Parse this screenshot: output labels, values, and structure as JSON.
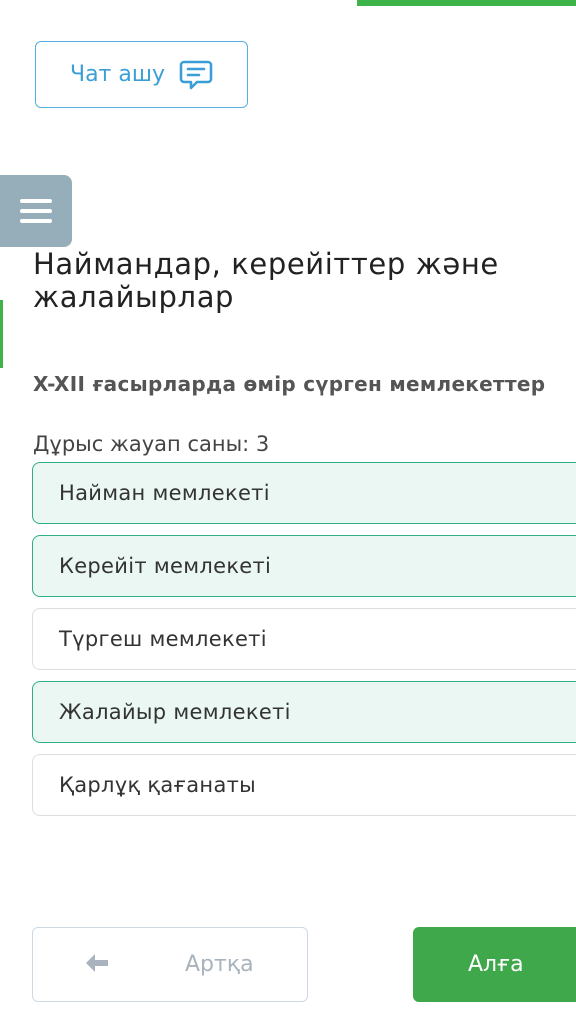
{
  "chat": {
    "label": "Чат ашу",
    "icon": "chat-icon"
  },
  "menu": {
    "icon": "hamburger-menu-icon"
  },
  "lesson": {
    "title": "Наймандар, керейіттер және жалайырлар"
  },
  "question": {
    "text": "X-XII ғасырларда өмір сүрген мемлекеттер",
    "answer_count_label": "Дұрыс жауап саны: 3"
  },
  "options": [
    {
      "label": "Найман мемлекеті",
      "selected": true
    },
    {
      "label": "Керейіт мемлекеті",
      "selected": true
    },
    {
      "label": "Түргеш мемлекеті",
      "selected": false
    },
    {
      "label": "Жалайыр мемлекеті",
      "selected": true
    },
    {
      "label": "Қарлұқ қағанаты",
      "selected": false
    }
  ],
  "navigation": {
    "back_label": "Артқа",
    "back_icon": "arrow-left-icon",
    "next_label": "Алға"
  },
  "colors": {
    "accent_green": "#3ea84a",
    "selected_border": "#2fae87",
    "selected_bg": "#ebf7f2",
    "chat_blue": "#3a9fd8",
    "menu_gray": "#95aeba"
  }
}
